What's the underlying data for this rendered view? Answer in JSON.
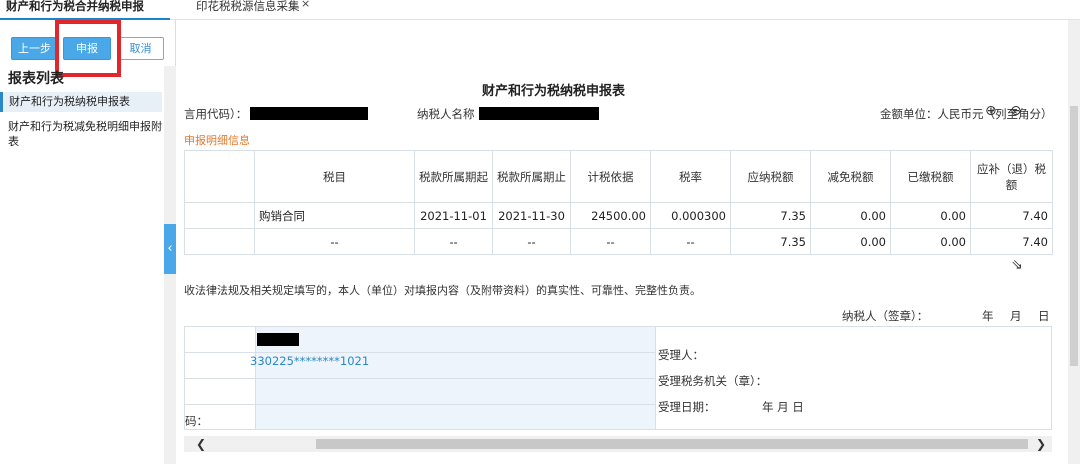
{
  "tabs": [
    {
      "label": "财产和行为税合并纳税申报"
    },
    {
      "label": "印花税税源信息采集"
    }
  ],
  "tab_close": "×",
  "toolbar": {
    "prev": "上一步",
    "submit": "申报",
    "cancel": "取消"
  },
  "report_list": {
    "title": "报表列表",
    "items": [
      "财产和行为税纳税申报表",
      "财产和行为税减免税明细申报附表"
    ]
  },
  "form": {
    "title": "财产和行为税纳税申报表",
    "credit_code_label": "言用代码）：",
    "taxpayer_name_label": "纳税人名称",
    "amount_unit": "金额单位：人民币元（列至角分）",
    "section_title": "申报明细信息",
    "columns": [
      "",
      "税目",
      "税款所属期起",
      "税款所属期止",
      "计税依据",
      "税率",
      "应纳税额",
      "减免税额",
      "已缴税额",
      "应补（退）税额"
    ],
    "rows": [
      [
        "",
        "购销合同",
        "2021-11-01",
        "2021-11-30",
        "24500.00",
        "0.000300",
        "7.35",
        "0.00",
        "0.00",
        "7.40"
      ],
      [
        "",
        "--",
        "--",
        "--",
        "--",
        "--",
        "7.35",
        "0.00",
        "0.00",
        "7.40"
      ]
    ],
    "declaration": "收法律法规及相关规定填写的，本人（单位）对填报内容（及附带资料）的真实性、可靠性、完整性负责。",
    "taxpayer_sign": "纳税人（签章）：",
    "date_year": "年",
    "date_month": "月",
    "date_day": "日",
    "id_number": "330225********1021",
    "code_label": "码：",
    "handler_label": "受理人：",
    "tax_office_label": "受理税务机关（章）：",
    "accept_date_label": "受理日期：",
    "accept_date_value": "年   月   日"
  }
}
